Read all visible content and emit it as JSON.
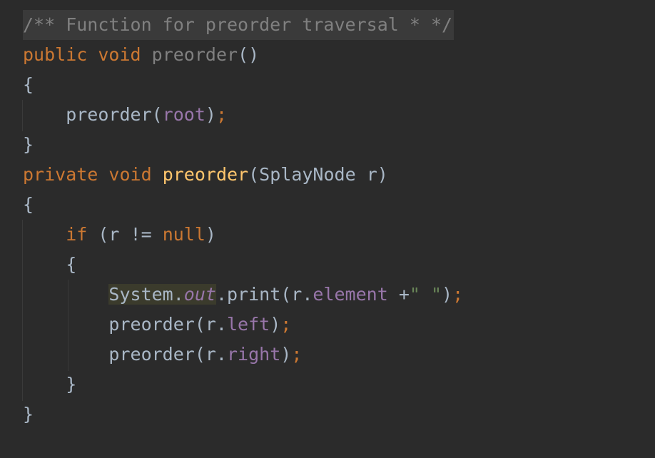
{
  "editor": {
    "lines": [
      {
        "tokens": [
          {
            "t": "/** Function for preorder traversal * */",
            "c": "t-comment"
          }
        ]
      },
      {
        "tokens": [
          {
            "t": "public",
            "c": "t-kw"
          },
          {
            "t": " ",
            "c": "t-plain"
          },
          {
            "t": "void",
            "c": "t-kw"
          },
          {
            "t": " ",
            "c": "t-plain"
          },
          {
            "t": "preorder",
            "c": "t-fn-unused"
          },
          {
            "t": "()",
            "c": "t-plain"
          }
        ]
      },
      {
        "tokens": [
          {
            "t": "{",
            "c": "t-plain"
          }
        ]
      },
      {
        "tokens": [
          {
            "t": "    preorder(",
            "c": "t-plain"
          },
          {
            "t": "root",
            "c": "t-field"
          },
          {
            "t": ")",
            "c": "t-plain"
          },
          {
            "t": ";",
            "c": "t-semi"
          }
        ]
      },
      {
        "tokens": [
          {
            "t": "}",
            "c": "t-plain"
          }
        ]
      },
      {
        "tokens": [
          {
            "t": "private",
            "c": "t-kw"
          },
          {
            "t": " ",
            "c": "t-plain"
          },
          {
            "t": "void",
            "c": "t-kw"
          },
          {
            "t": " ",
            "c": "t-plain"
          },
          {
            "t": "preorder",
            "c": "t-fn-decl"
          },
          {
            "t": "(SplayNode r)",
            "c": "t-plain"
          }
        ]
      },
      {
        "tokens": [
          {
            "t": "{",
            "c": "t-plain"
          }
        ]
      },
      {
        "tokens": [
          {
            "t": "    ",
            "c": "t-plain"
          },
          {
            "t": "if",
            "c": "t-kw"
          },
          {
            "t": " (r != ",
            "c": "t-plain"
          },
          {
            "t": "null",
            "c": "t-kw"
          },
          {
            "t": ")",
            "c": "t-plain"
          }
        ]
      },
      {
        "tokens": [
          {
            "t": "    {",
            "c": "t-plain"
          }
        ]
      },
      {
        "tokens": [
          {
            "t": "        ",
            "c": "t-plain"
          },
          {
            "t": "System.",
            "c": "t-plain hl-usage"
          },
          {
            "t": "out",
            "c": "t-field-italic hl-usage"
          },
          {
            "t": ".print(r.",
            "c": "t-plain"
          },
          {
            "t": "element",
            "c": "t-field"
          },
          {
            "t": " +",
            "c": "t-plain"
          },
          {
            "t": "\" \"",
            "c": "t-str"
          },
          {
            "t": ")",
            "c": "t-plain"
          },
          {
            "t": ";",
            "c": "t-semi"
          }
        ]
      },
      {
        "tokens": [
          {
            "t": "        preorder(r.",
            "c": "t-plain"
          },
          {
            "t": "left",
            "c": "t-field"
          },
          {
            "t": ")",
            "c": "t-plain"
          },
          {
            "t": ";",
            "c": "t-semi"
          }
        ]
      },
      {
        "tokens": [
          {
            "t": "        preorder(r.",
            "c": "t-plain"
          },
          {
            "t": "right",
            "c": "t-field"
          },
          {
            "t": ")",
            "c": "t-plain"
          },
          {
            "t": ";",
            "c": "t-semi"
          }
        ]
      },
      {
        "tokens": [
          {
            "t": "    }",
            "c": "t-plain"
          }
        ]
      },
      {
        "tokens": [
          {
            "t": "}",
            "c": "t-plain"
          }
        ]
      }
    ]
  },
  "colors": {
    "background": "#2b2b2b",
    "keyword": "#cc7832",
    "comment": "#808080",
    "function_declaration": "#ffc66d",
    "field": "#9876aa",
    "string": "#6a8759",
    "default_text": "#a9b7c6"
  }
}
